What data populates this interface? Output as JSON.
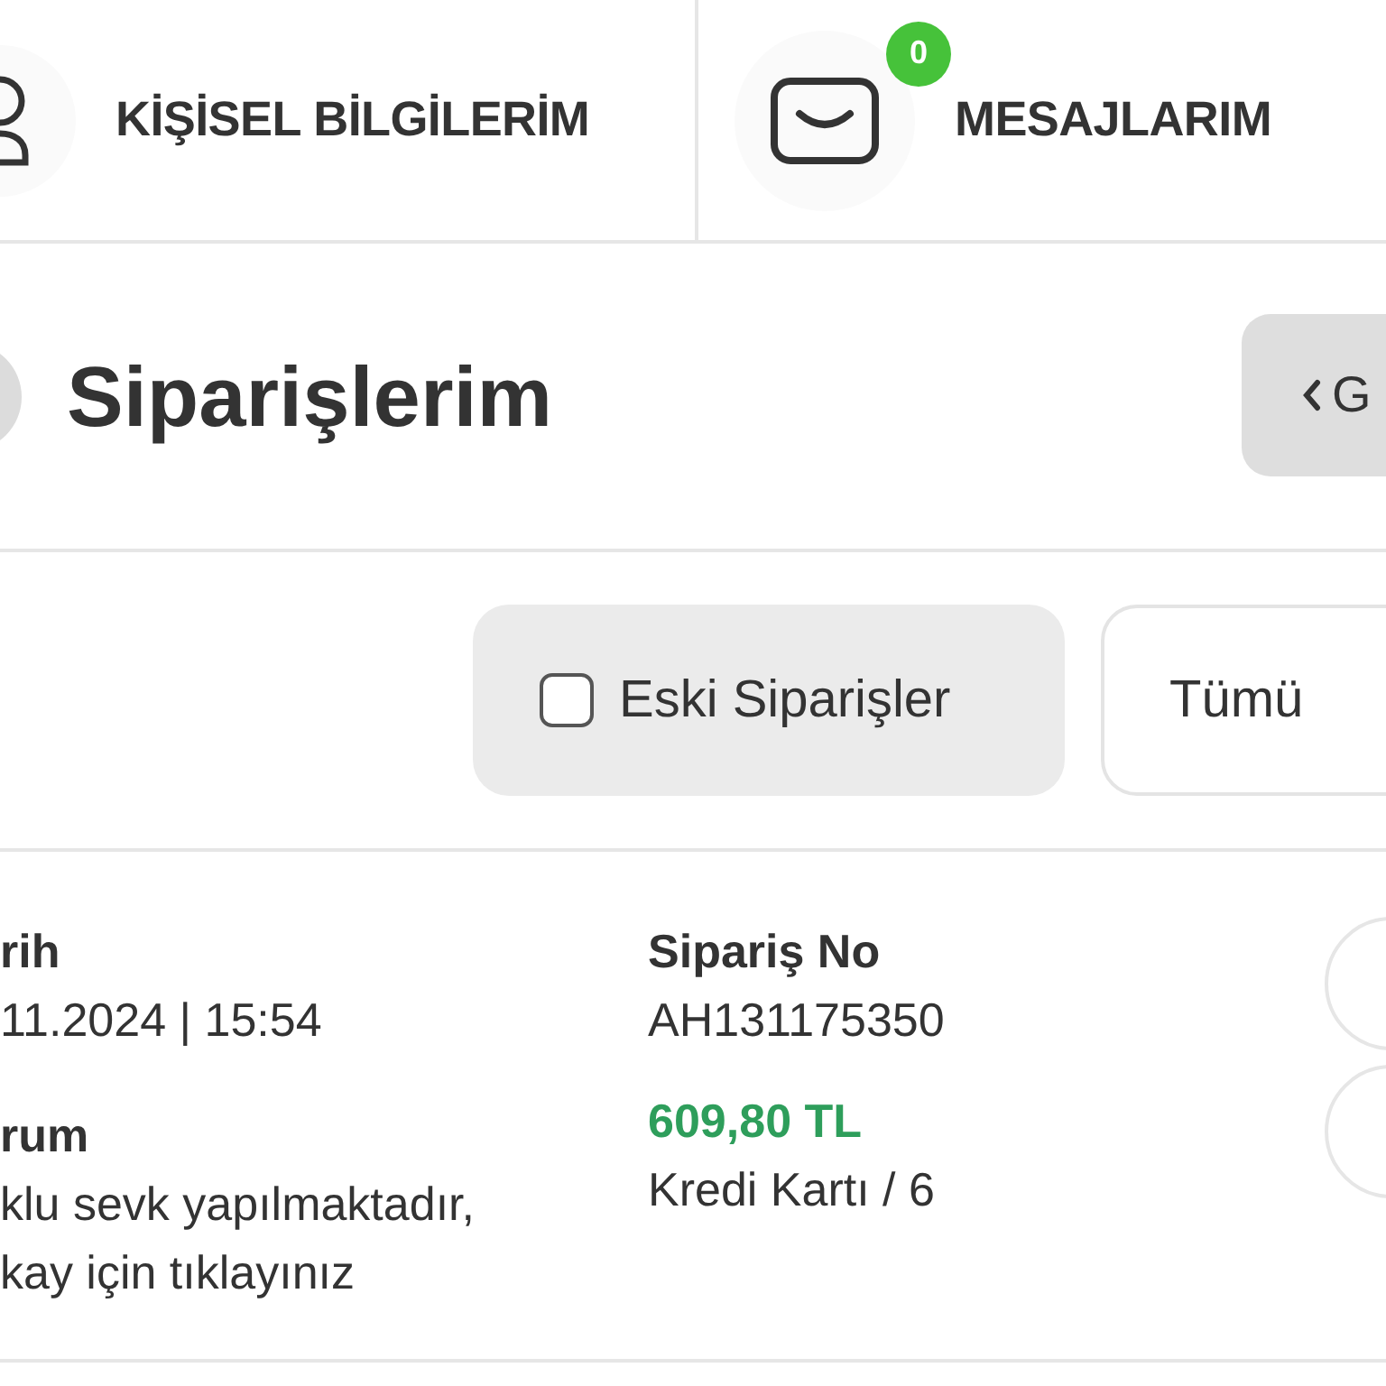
{
  "nav": [
    {
      "kind": "profile",
      "label": "KİŞİSEL BİLGİLERİM"
    },
    {
      "kind": "messages",
      "label": "MESAJLARIM",
      "badge": "0"
    }
  ],
  "header": {
    "title": "Siparişlerim",
    "back_button": "G"
  },
  "filters": [
    {
      "kind": "checkbox",
      "label": "Eski Siparişler",
      "checked": false
    },
    {
      "kind": "select",
      "label": "Tümü"
    }
  ],
  "order": {
    "date_label": "rih",
    "date": "11.2024 | 15:54",
    "status_label": "rum",
    "status_lines": [
      "klu sevk yapılmaktadır,",
      "kay için tıklayınız"
    ],
    "order_no_label": "Sipariş No",
    "order_no": "AH131175350",
    "total": "609,80 TL",
    "payment": "Kredi Kartı / 6"
  }
}
